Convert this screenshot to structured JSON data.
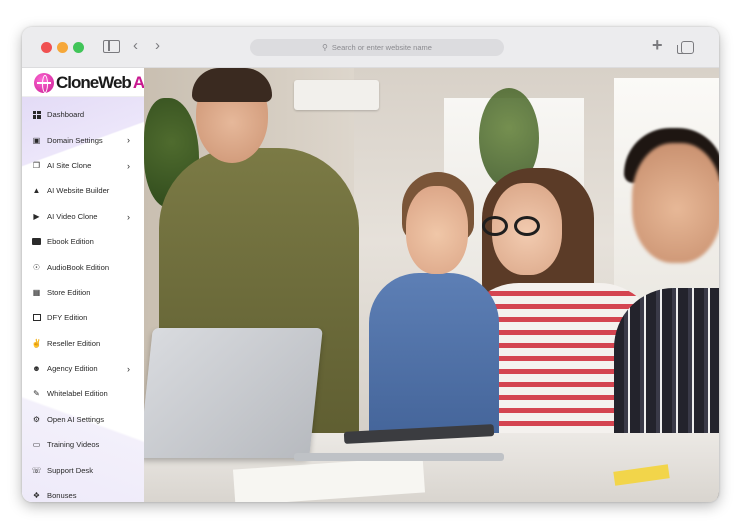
{
  "browser": {
    "address_placeholder": "Search or enter website name"
  },
  "logo": {
    "name_part": "CloneWeb",
    "ai_part": "AI"
  },
  "sidebar": {
    "items": [
      {
        "label": "Dashboard",
        "icon": "dashboard-grid-icon",
        "has_submenu": false
      },
      {
        "label": "Domain Settings",
        "icon": "domain-icon",
        "has_submenu": true
      },
      {
        "label": "AI Site Clone",
        "icon": "copy-icon",
        "has_submenu": true
      },
      {
        "label": "AI Website Builder",
        "icon": "shapes-icon",
        "has_submenu": false
      },
      {
        "label": "AI Video Clone",
        "icon": "video-icon",
        "has_submenu": true
      },
      {
        "label": "Ebook Edition",
        "icon": "book-icon",
        "has_submenu": false
      },
      {
        "label": "AudioBook Edition",
        "icon": "headphones-icon",
        "has_submenu": false
      },
      {
        "label": "Store Edition",
        "icon": "store-icon",
        "has_submenu": false
      },
      {
        "label": "DFY Edition",
        "icon": "package-icon",
        "has_submenu": false
      },
      {
        "label": "Reseller Edition",
        "icon": "handshake-icon",
        "has_submenu": false
      },
      {
        "label": "Agency Edition",
        "icon": "users-icon",
        "has_submenu": true
      },
      {
        "label": "Whitelabel Edition",
        "icon": "edit-icon",
        "has_submenu": false
      },
      {
        "label": "Open AI Settings",
        "icon": "gear-icon",
        "has_submenu": false
      },
      {
        "label": "Training Videos",
        "icon": "monitor-icon",
        "has_submenu": false
      },
      {
        "label": "Support Desk",
        "icon": "support-icon",
        "has_submenu": false
      },
      {
        "label": "Bonuses",
        "icon": "gift-icon",
        "has_submenu": false
      }
    ]
  },
  "colors": {
    "brand": "#c8188f",
    "sidebar_accent": "#e8e0f7"
  }
}
